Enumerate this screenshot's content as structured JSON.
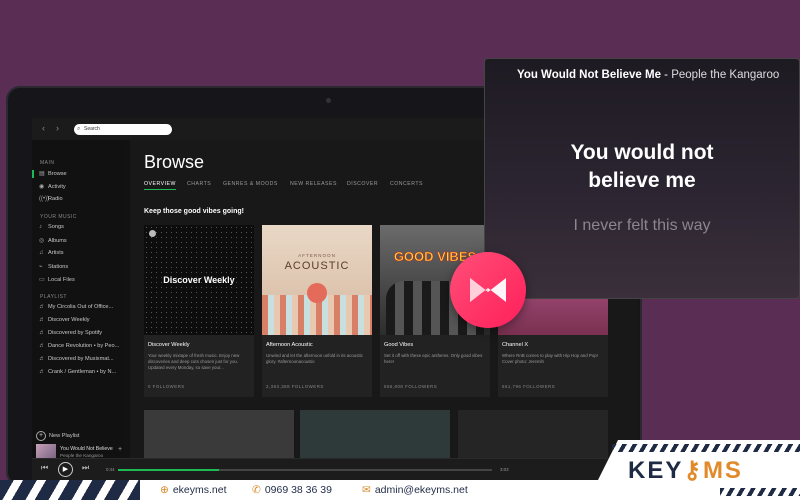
{
  "spotify": {
    "search_placeholder": "Search",
    "sidebar": {
      "main_header": "MAIN",
      "main_items": [
        {
          "label": "Browse",
          "icon": "browse-icon"
        },
        {
          "label": "Activity",
          "icon": "activity-icon"
        },
        {
          "label": "Radio",
          "icon": "radio-icon"
        }
      ],
      "your_music_header": "YOUR MUSIC",
      "your_music_items": [
        {
          "label": "Songs",
          "icon": "music-note-icon"
        },
        {
          "label": "Albums",
          "icon": "album-icon"
        },
        {
          "label": "Artists",
          "icon": "artist-icon"
        },
        {
          "label": "Stations",
          "icon": "station-icon"
        },
        {
          "label": "Local Files",
          "icon": "file-icon"
        }
      ],
      "playlist_header": "PLAYLIST",
      "playlists": [
        "My Circolia Out of Office...",
        "Discover Weekly",
        "Discovered by Spotify",
        "Dance Revolution • by Peo...",
        "Discovered by Musixmat...",
        "Crank / Gentleman • by N..."
      ],
      "new_playlist": "New Playlist",
      "now_playing": {
        "title": "You Would Not Believe",
        "artist": "People the Kangaroo"
      }
    },
    "main": {
      "title": "Browse",
      "tabs": [
        "OVERVIEW",
        "CHARTS",
        "GENRES & MOODS",
        "NEW RELEASES",
        "DISCOVER",
        "CONCERTS"
      ],
      "active_tab": "OVERVIEW",
      "section_heading": "Keep those good vibes going!",
      "cards": [
        {
          "title": "Discover Weekly",
          "desc": "Your weekly mixtape of fresh music. Enjoy new discoveries and deep cuts chosen just for you. Updated every Monday, so save your...",
          "followers": "0 FOLLOWERS",
          "art_text": "Discover Weekly"
        },
        {
          "title": "Afternoon Acoustic",
          "desc": "Unwind and let the afternoon unfold in its acoustic glory. #afternoonacoustic",
          "followers": "2,363,388 FOLLOWERS",
          "art_small": "AFTERNOON",
          "art_text": "ACOUSTIC"
        },
        {
          "title": "Good Vibes",
          "desc": "Set it off with these epic anthems. Only good vibes here!",
          "followers": "566,808 FOLLOWERS",
          "art_text": "GOOD VIBES"
        },
        {
          "title": "Channel X",
          "desc": "Where RnB comes to play with Hip Hop and Pop! Cover photo: Jeremih",
          "followers": "561,796 FOLLOWERS"
        }
      ]
    },
    "player": {
      "current_time": "0:44",
      "total_time": "3:03",
      "progress": 0.27
    }
  },
  "lyrics": {
    "song": "You Would Not Believe Me",
    "separator": " - ",
    "artist": "People the Kangaroo",
    "current_line_1": "You would not",
    "current_line_2": "believe me",
    "next_line": "I never felt this way"
  },
  "footer": {
    "website": "ekeyms.net",
    "phone": "0969 38 36 39",
    "email": "admin@ekeyms.net"
  },
  "brand": {
    "name_a": "KEY",
    "name_b": "MS"
  },
  "colors": {
    "accent_green": "#1db954",
    "background_purple": "#5a2d54",
    "musixmatch_pink": "#ff3a68",
    "brand_navy": "#1f2a44",
    "brand_orange": "#e08a2a"
  }
}
